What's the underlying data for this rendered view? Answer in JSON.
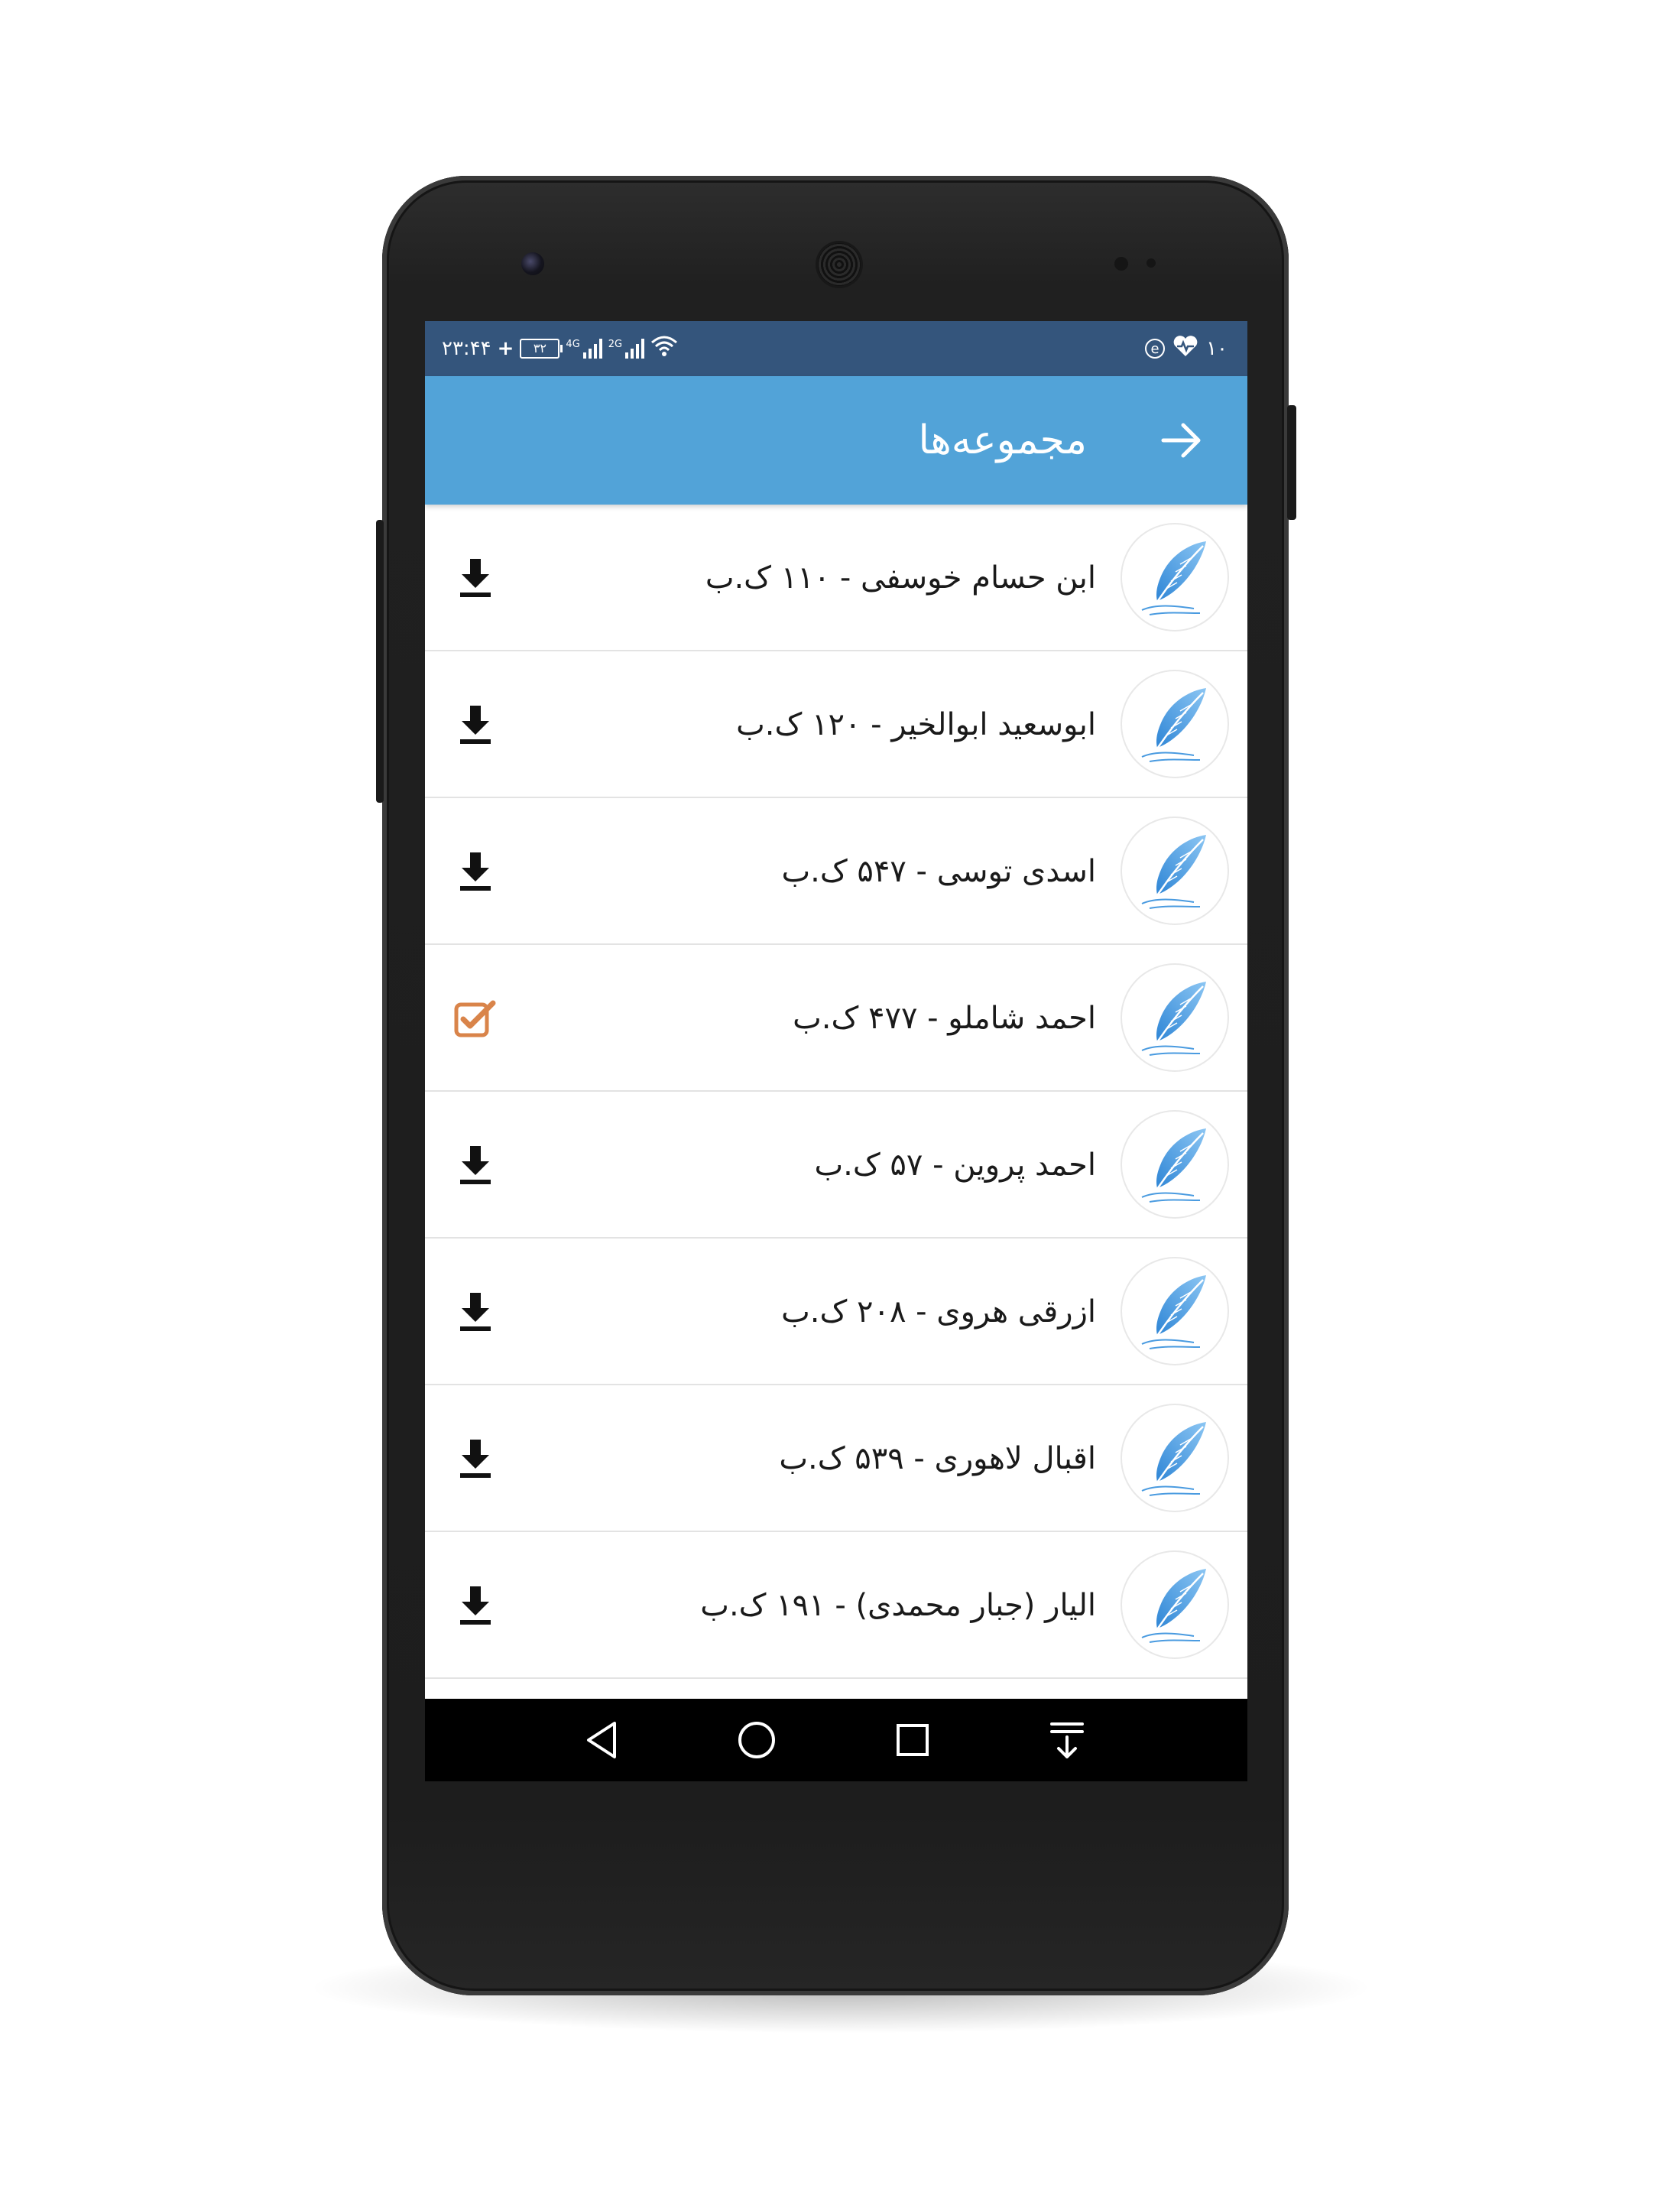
{
  "status_bar": {
    "time": "۲۳:۴۴",
    "plus": "+",
    "battery_level": "۳۲",
    "network_1": "4G",
    "network_2": "2G",
    "notification_count": "۱۰",
    "icons": [
      "battery-icon",
      "signal-4g-icon",
      "signal-2g-icon",
      "wifi-icon",
      "e-icon",
      "heart-icon"
    ]
  },
  "app_bar": {
    "title": "مجموعه‌ها",
    "back_icon": "arrow-right-icon"
  },
  "collections": [
    {
      "label": "ابن حسام خوسفی - ۱۱۰ ک.ب",
      "status": "download"
    },
    {
      "label": "ابوسعید ابوالخیر - ۱۲۰ ک.ب",
      "status": "download"
    },
    {
      "label": "اسدی توسی - ۵۴۷ ک.ب",
      "status": "download"
    },
    {
      "label": "احمد شاملو - ۴۷۷ ک.ب",
      "status": "downloaded"
    },
    {
      "label": "احمد پروین - ۵۷ ک.ب",
      "status": "download"
    },
    {
      "label": "ازرقی هروی - ۲۰۸ ک.ب",
      "status": "download"
    },
    {
      "label": "اقبال لاهوری - ۵۳۹ ک.ب",
      "status": "download"
    },
    {
      "label": "الیار (جبار محمدی) - ۱۹۱ ک.ب",
      "status": "download"
    }
  ],
  "nav_bar": [
    "back-triangle-icon",
    "home-circle-icon",
    "recents-square-icon",
    "notifications-pull-icon"
  ],
  "colors": {
    "status_bar": "#34557c",
    "app_bar": "#52a3d8",
    "checkbox_accent": "#d9844a",
    "feather_blue": "#4a9be0"
  }
}
